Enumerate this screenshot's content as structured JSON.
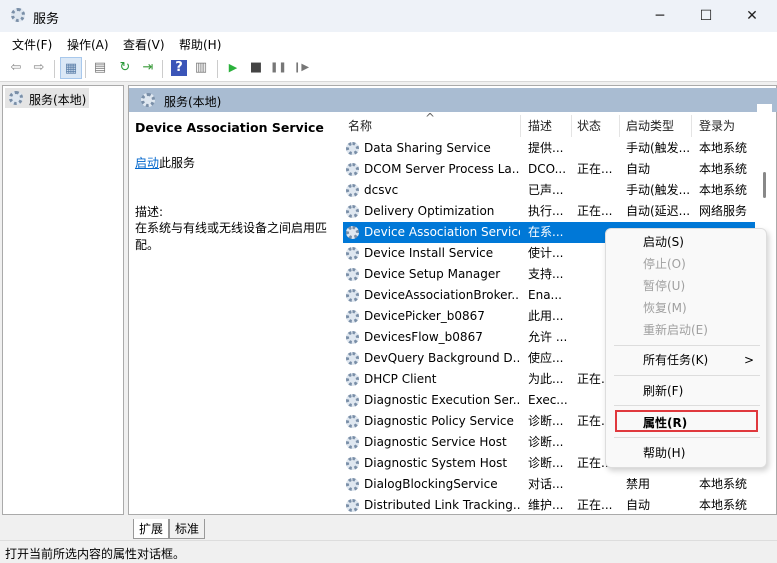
{
  "window": {
    "title": "服务",
    "minimize": "─",
    "maximize": "☐",
    "close": "✕"
  },
  "menubar": [
    "文件(F)",
    "操作(A)",
    "查看(V)",
    "帮助(H)"
  ],
  "toolbar": {
    "icons": [
      "back-icon",
      "forward-icon",
      "show-hide-tree-icon",
      "properties-icon",
      "refresh-icon",
      "export-icon",
      "help-icon",
      "console-icon",
      "start-icon",
      "stop-icon",
      "pause-icon",
      "resume-icon"
    ],
    "glyphs": [
      "⇦",
      "⇨",
      "▦",
      "▤",
      "↻",
      "⇥",
      "?",
      "▥",
      "▶",
      "■",
      "❚❚",
      "❙▶"
    ]
  },
  "tree": {
    "item": "服务(本地)"
  },
  "panel": {
    "header": "服务(本地)",
    "service_title": "Device Association Service",
    "start_link": "启动",
    "start_suffix": "此服务",
    "desc_label": "描述:",
    "desc_text": "在系统与有线或无线设备之间启用匹配。"
  },
  "columns": [
    "名称",
    "描述",
    "状态",
    "启动类型",
    "登录为"
  ],
  "sort_indicator": "^",
  "rows": [
    [
      "Data Sharing Service",
      "提供...",
      "",
      "手动(触发...",
      "本地系统"
    ],
    [
      "DCOM Server Process La...",
      "DCO...",
      "正在...",
      "自动",
      "本地系统"
    ],
    [
      "dcsvc",
      "已声...",
      "",
      "手动(触发...",
      "本地系统"
    ],
    [
      "Delivery Optimization",
      "执行...",
      "正在...",
      "自动(延迟...",
      "网络服务"
    ],
    [
      "Device Association Service",
      "在系...",
      "",
      "",
      ""
    ],
    [
      "Device Install Service",
      "使计...",
      "",
      "",
      ""
    ],
    [
      "Device Setup Manager",
      "支持...",
      "",
      "",
      ""
    ],
    [
      "DeviceAssociationBroker...",
      "Ena...",
      "",
      "",
      ""
    ],
    [
      "DevicePicker_b0867",
      "此用...",
      "",
      "",
      ""
    ],
    [
      "DevicesFlow_b0867",
      "允许 ...",
      "",
      "",
      ""
    ],
    [
      "DevQuery Background D...",
      "使应...",
      "",
      "",
      ""
    ],
    [
      "DHCP Client",
      "为此...",
      "正在...",
      "",
      ""
    ],
    [
      "Diagnostic Execution Ser...",
      "Exec...",
      "",
      "",
      ""
    ],
    [
      "Diagnostic Policy Service",
      "诊断...",
      "正在...",
      "",
      ""
    ],
    [
      "Diagnostic Service Host",
      "诊断...",
      "",
      "",
      ""
    ],
    [
      "Diagnostic System Host",
      "诊断...",
      "正在...",
      "",
      ""
    ],
    [
      "DialogBlockingService",
      "对话...",
      "",
      "禁用",
      "本地系统"
    ],
    [
      "Distributed Link Tracking...",
      "维护...",
      "正在...",
      "自动",
      "本地系统"
    ]
  ],
  "selected_row": 4,
  "context_menu": {
    "items": [
      {
        "label": "启动(S)",
        "enabled": true
      },
      {
        "label": "停止(O)",
        "enabled": false
      },
      {
        "label": "暂停(U)",
        "enabled": false
      },
      {
        "label": "恢复(M)",
        "enabled": false
      },
      {
        "label": "重新启动(E)",
        "enabled": false
      },
      {
        "label": "所有任务(K)",
        "enabled": true,
        "submenu": ">"
      },
      {
        "label": "刷新(F)",
        "enabled": true
      },
      {
        "label": "属性(R)",
        "enabled": true,
        "highlighted": true
      },
      {
        "label": "帮助(H)",
        "enabled": true
      }
    ]
  },
  "tabs": [
    "扩展",
    "标准"
  ],
  "status": "打开当前所选内容的属性对话框。",
  "colors": {
    "selection": "#0078d7",
    "highlight_box": "#e0393e",
    "header": "#a9bcd2"
  }
}
